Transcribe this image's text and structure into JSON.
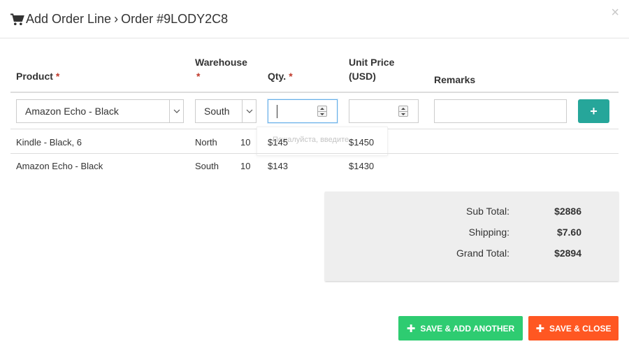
{
  "header": {
    "title": "Add Order Line",
    "separator": "›",
    "order_ref": "Order #9LODY2C8",
    "close_label": "×"
  },
  "columns": {
    "product": "Product",
    "warehouse": "Warehouse",
    "qty": "Qty.",
    "unit_price_line1": "Unit Price",
    "unit_price_line2": "(USD)",
    "remarks": "Remarks",
    "required_mark": "*"
  },
  "form": {
    "product_selected": "Amazon Echo - Black",
    "warehouse_selected": "South",
    "qty_value": "",
    "unit_price_value": "",
    "remarks_value": "",
    "add_label": "+"
  },
  "tooltip": {
    "text": "Пожалуйста, введите"
  },
  "lines": [
    {
      "product": "Kindle - Black, 6",
      "warehouse": "North",
      "qty": "10",
      "unit_price": "$145",
      "total": "$1450"
    },
    {
      "product": "Amazon Echo - Black",
      "warehouse": "South",
      "qty": "10",
      "unit_price": "$143",
      "total": "$1430"
    }
  ],
  "totals": {
    "subtotal_label": "Sub Total:",
    "subtotal_value": "$2886",
    "shipping_label": "Shipping:",
    "shipping_value": "$7.60",
    "grand_label": "Grand Total:",
    "grand_value": "$2894"
  },
  "footer": {
    "save_add_another": "SAVE & ADD ANOTHER",
    "save_close": "SAVE & CLOSE",
    "plus": "✚"
  },
  "colors": {
    "add_button": "#26a69a",
    "save_add_button": "#2ecc71",
    "save_close_button": "#ff5722",
    "required": "#c0392b"
  },
  "icons": {
    "title": "shopping-cart-icon",
    "close": "close-icon",
    "dropdown": "chevron-down-icon",
    "add": "plus-icon"
  }
}
